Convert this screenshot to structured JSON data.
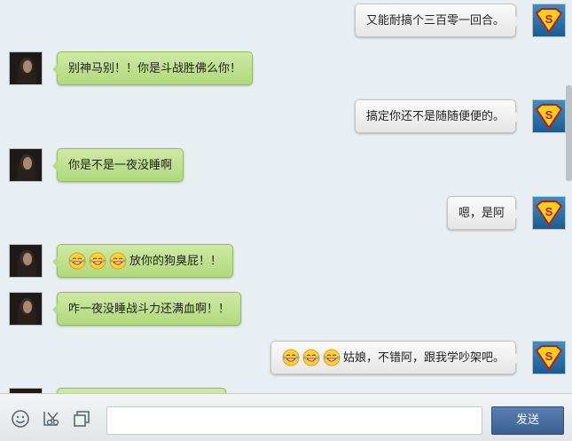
{
  "messages": [
    {
      "side": "right",
      "text": "又能耐搞个三百零一回合。",
      "emoji_count": 0
    },
    {
      "side": "left",
      "text": "别神马别！！你是斗战胜佛么你！",
      "emoji_count": 0
    },
    {
      "side": "right",
      "text": "搞定你还不是随随便便的。",
      "emoji_count": 0
    },
    {
      "side": "left",
      "text": "你是不是一夜没睡啊",
      "emoji_count": 0
    },
    {
      "side": "right",
      "text": "嗯，是阿",
      "emoji_count": 0
    },
    {
      "side": "left",
      "text": "放你的狗臭屁！！",
      "emoji_count": 3
    },
    {
      "side": "left",
      "text": "咋一夜没睡战斗力还满血啊！！",
      "emoji_count": 0
    },
    {
      "side": "right",
      "text": "姑娘，不错阿，跟我学吵架吧。",
      "emoji_count": 3
    }
  ],
  "icons": {
    "left_avatar": "long-hair-portrait-icon",
    "right_avatar": "superman-shield-icon",
    "emoji": "grinning-tears-emoji-icon",
    "emoticon_tool": "smiley-icon",
    "screenshot_tool": "scissors-icon",
    "window_tool": "window-icon"
  },
  "input": {
    "value": "",
    "placeholder": ""
  },
  "toolbar": {
    "send_label": "发送"
  },
  "colors": {
    "left_bubble": "#b8dc86",
    "right_bubble": "#ededed",
    "send_button": "#4a6ea0",
    "chat_background": "#e8eef1"
  }
}
